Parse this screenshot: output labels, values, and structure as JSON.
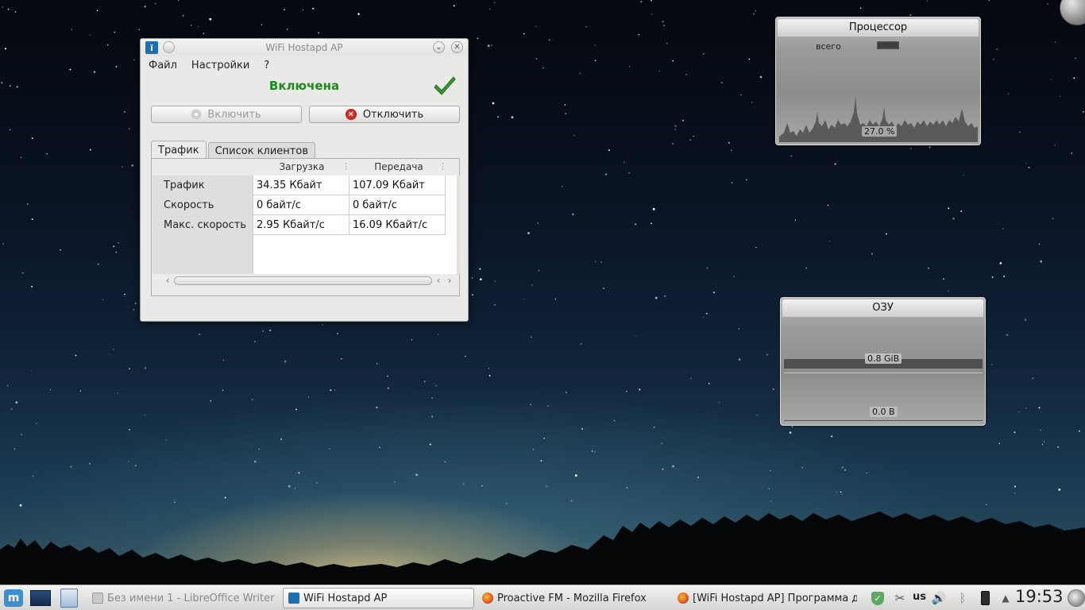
{
  "window": {
    "title": "WiFi Hostapd AP",
    "menu": [
      "Файл",
      "Настройки",
      "?"
    ],
    "status": "Включена",
    "enable_label": "Включить",
    "disable_label": "Отключить",
    "tabs": [
      "Трафик",
      "Список клиентов"
    ],
    "columns": [
      "Загрузка",
      "Передача"
    ],
    "rows": [
      {
        "label": "Трафик",
        "download": "34.35 Кбайт",
        "upload": "107.09 Кбайт"
      },
      {
        "label": "Скорость",
        "download": "0 байт/с",
        "upload": "0 байт/с"
      },
      {
        "label": "Макс. скорость",
        "download": "2.95 Кбайт/с",
        "upload": "16.09 Кбайт/с"
      }
    ]
  },
  "cpu_widget": {
    "title": "Процессор",
    "legend": "всего",
    "value": "27.0 %"
  },
  "ram_widget": {
    "title": "ОЗУ",
    "value_ram": "0.8 GiB",
    "value_swap": "0.0 B"
  },
  "taskbar": {
    "tasks": [
      {
        "label": "Без имени 1 - LibreOffice Writer",
        "icon": "document-icon",
        "state": "inactive"
      },
      {
        "label": "WiFi Hostapd AP",
        "icon": "wifi-app-icon",
        "state": "active"
      },
      {
        "label": "Proactive FM - Mozilla Firefox",
        "icon": "firefox-icon",
        "state": "normal"
      },
      {
        "label": "[WiFi Hostapd AP] Программа дл",
        "icon": "firefox-icon",
        "state": "normal"
      }
    ],
    "keyboard_layout": "us",
    "clock": "19:53"
  },
  "colors": {
    "status_green": "#1c8a1c",
    "sky_dark": "#05080f",
    "horizon_glow": "#f0d28c"
  }
}
